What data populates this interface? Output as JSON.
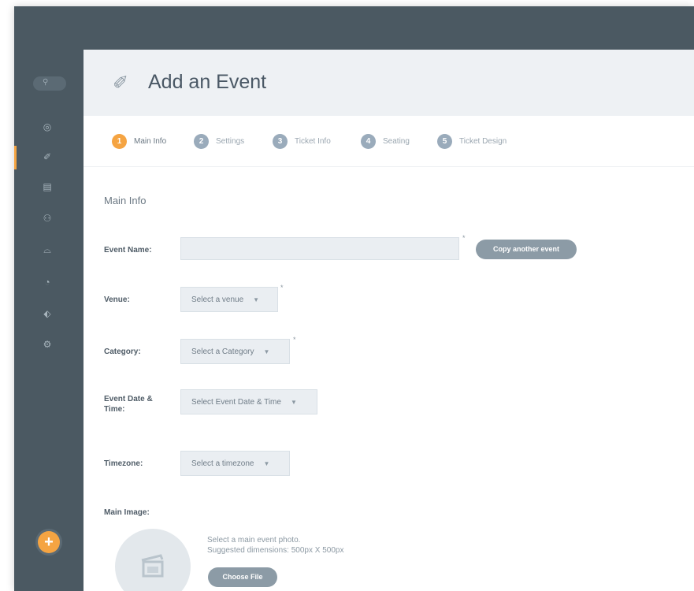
{
  "app": {
    "accent_color": "#f5a442",
    "sidebar_color": "#4b5962"
  },
  "sidebar": {
    "search_icon": "search-icon",
    "items": [
      {
        "icon": "dashboard-icon",
        "glyph": "◎"
      },
      {
        "icon": "ticket-icon",
        "glyph": "✐",
        "active": true
      },
      {
        "icon": "calendar-icon",
        "glyph": "▤"
      },
      {
        "icon": "users-icon",
        "glyph": "⚇"
      },
      {
        "icon": "venue-icon",
        "glyph": "⌓"
      },
      {
        "icon": "chart-icon",
        "glyph": "◔"
      },
      {
        "icon": "tags-icon",
        "glyph": "⬖"
      },
      {
        "icon": "settings-icon",
        "glyph": "⚙"
      }
    ],
    "add_label": "+"
  },
  "header": {
    "title": "Add an Event",
    "icon": "ticket-icon"
  },
  "steps": [
    {
      "number": "1",
      "label": "Main Info",
      "active": true
    },
    {
      "number": "2",
      "label": "Settings"
    },
    {
      "number": "3",
      "label": "Ticket Info"
    },
    {
      "number": "4",
      "label": "Seating"
    },
    {
      "number": "5",
      "label": "Ticket Design"
    }
  ],
  "form": {
    "section_title": "Main Info",
    "event_name": {
      "label": "Event Name:",
      "value": "",
      "required": "*"
    },
    "copy_button": "Copy another event",
    "venue": {
      "label": "Venue:",
      "placeholder": "Select a venue",
      "required": "*"
    },
    "category": {
      "label": "Category:",
      "placeholder": "Select a Category",
      "required": "*"
    },
    "event_date": {
      "label_line1": "Event Date &",
      "label_line2": "Time:",
      "placeholder": "Select Event Date & Time"
    },
    "timezone": {
      "label": "Timezone:",
      "placeholder": "Select a timezone"
    },
    "main_image": {
      "label": "Main Image:",
      "hint_line1": "Select a main event photo.",
      "hint_line2": "Suggested dimensions: 500px X 500px",
      "button": "Choose File"
    }
  }
}
